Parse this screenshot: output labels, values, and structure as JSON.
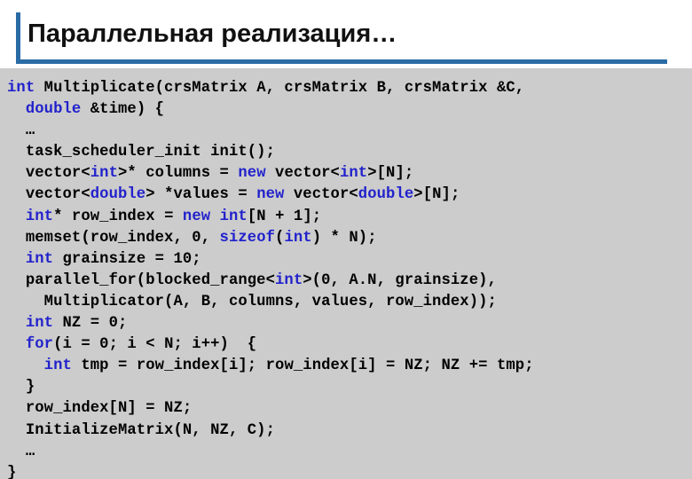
{
  "slide": {
    "title": "Параллельная реализация…",
    "accent_color": "#2a6ba6",
    "code_background": "#cccccc",
    "keyword_color": "#2222cc",
    "text_color": "#000000"
  },
  "code": {
    "language": "cpp",
    "lines": [
      {
        "id": "line-1",
        "text": "int Multiplicate(crsMatrix A, crsMatrix B, crsMatrix &C,"
      },
      {
        "id": "line-2",
        "text": "  double &time) {"
      },
      {
        "id": "line-3",
        "text": "  …"
      },
      {
        "id": "line-4",
        "text": "  task_scheduler_init init();"
      },
      {
        "id": "line-5",
        "text": "  vector<int>* columns = new vector<int>[N];"
      },
      {
        "id": "line-6",
        "text": "  vector<double> *values = new vector<double>[N];"
      },
      {
        "id": "line-7",
        "text": "  int* row_index = new int[N + 1];"
      },
      {
        "id": "line-8",
        "text": "  memset(row_index, 0, sizeof(int) * N);"
      },
      {
        "id": "line-9",
        "text": "  int grainsize = 10;"
      },
      {
        "id": "line-10",
        "text": "  parallel_for(blocked_range<int>(0, A.N, grainsize),"
      },
      {
        "id": "line-11",
        "text": "    Multiplicator(A, B, columns, values, row_index));"
      },
      {
        "id": "line-12",
        "text": "  int NZ = 0;"
      },
      {
        "id": "line-13",
        "text": "  for(i = 0; i < N; i++)  {"
      },
      {
        "id": "line-14",
        "text": "    int tmp = row_index[i]; row_index[i] = NZ; NZ += tmp;"
      },
      {
        "id": "line-15",
        "text": "  }"
      },
      {
        "id": "line-16",
        "text": "  row_index[N] = NZ;"
      },
      {
        "id": "line-17",
        "text": "  InitializeMatrix(N, NZ, C);"
      },
      {
        "id": "line-18",
        "text": "  …"
      },
      {
        "id": "line-19",
        "text": "}"
      }
    ],
    "segments": [
      [
        {
          "t": "int",
          "k": 1
        },
        {
          "t": " Multiplicate(crsMatrix A, crsMatrix B, crsMatrix &C,",
          "k": 0
        }
      ],
      [
        {
          "t": "  ",
          "k": 0
        },
        {
          "t": "double",
          "k": 1
        },
        {
          "t": " &time) {",
          "k": 0
        }
      ],
      [
        {
          "t": "  …",
          "k": 0
        }
      ],
      [
        {
          "t": "  task_scheduler_init init();",
          "k": 0
        }
      ],
      [
        {
          "t": "  vector<",
          "k": 0
        },
        {
          "t": "int",
          "k": 1
        },
        {
          "t": ">* columns = ",
          "k": 0
        },
        {
          "t": "new",
          "k": 1
        },
        {
          "t": " vector<",
          "k": 0
        },
        {
          "t": "int",
          "k": 1
        },
        {
          "t": ">[N];",
          "k": 0
        }
      ],
      [
        {
          "t": "  vector<",
          "k": 0
        },
        {
          "t": "double",
          "k": 1
        },
        {
          "t": "> *values = ",
          "k": 0
        },
        {
          "t": "new",
          "k": 1
        },
        {
          "t": " vector<",
          "k": 0
        },
        {
          "t": "double",
          "k": 1
        },
        {
          "t": ">[N];",
          "k": 0
        }
      ],
      [
        {
          "t": "  ",
          "k": 0
        },
        {
          "t": "int",
          "k": 1
        },
        {
          "t": "* row_index = ",
          "k": 0
        },
        {
          "t": "new",
          "k": 1
        },
        {
          "t": " ",
          "k": 0
        },
        {
          "t": "int",
          "k": 1
        },
        {
          "t": "[N + 1];",
          "k": 0
        }
      ],
      [
        {
          "t": "  memset(row_index, 0, ",
          "k": 0
        },
        {
          "t": "sizeof",
          "k": 1
        },
        {
          "t": "(",
          "k": 0
        },
        {
          "t": "int",
          "k": 1
        },
        {
          "t": ") * N);",
          "k": 0
        }
      ],
      [
        {
          "t": "  ",
          "k": 0
        },
        {
          "t": "int",
          "k": 1
        },
        {
          "t": " grainsize = 10;",
          "k": 0
        }
      ],
      [
        {
          "t": "  parallel_for(blocked_range<",
          "k": 0
        },
        {
          "t": "int",
          "k": 1
        },
        {
          "t": ">(0, A.N, grainsize),",
          "k": 0
        }
      ],
      [
        {
          "t": "    Multiplicator(A, B, columns, values, row_index));",
          "k": 0
        }
      ],
      [
        {
          "t": "  ",
          "k": 0
        },
        {
          "t": "int",
          "k": 1
        },
        {
          "t": " NZ = 0;",
          "k": 0
        }
      ],
      [
        {
          "t": "  ",
          "k": 0
        },
        {
          "t": "for",
          "k": 1
        },
        {
          "t": "(i = 0; i < N; i++)  {",
          "k": 0
        }
      ],
      [
        {
          "t": "    ",
          "k": 0
        },
        {
          "t": "int",
          "k": 1
        },
        {
          "t": " tmp = row_index[i]; row_index[i] = NZ; NZ += tmp;",
          "k": 0
        }
      ],
      [
        {
          "t": "  }",
          "k": 0
        }
      ],
      [
        {
          "t": "  row_index[N] = NZ;",
          "k": 0
        }
      ],
      [
        {
          "t": "  InitializeMatrix(N, NZ, C);",
          "k": 0
        }
      ],
      [
        {
          "t": "  …",
          "k": 0
        }
      ],
      [
        {
          "t": "}",
          "k": 0
        }
      ]
    ]
  }
}
